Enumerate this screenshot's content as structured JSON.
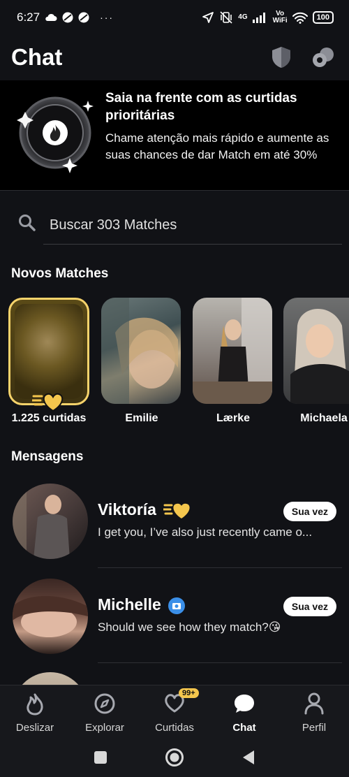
{
  "status_bar": {
    "time": "6:27",
    "dots": "···",
    "network_4g": "4G",
    "wifi_label_top": "Vo",
    "wifi_label_bottom": "WiFi",
    "battery": "100"
  },
  "header": {
    "title": "Chat",
    "icons": [
      "shield-icon",
      "chat-bubbles-icon"
    ]
  },
  "promo": {
    "title": "Saia na frente com as curtidas prioritárias",
    "description": "Chame atenção mais rápido e aumente as suas chances de dar Match em até 30%",
    "badge_icon": "flame-icon"
  },
  "search": {
    "placeholder": "Buscar 303 Matches"
  },
  "new_matches": {
    "label": "Novos Matches",
    "items": [
      {
        "name": "1.225 curtidas"
      },
      {
        "name": "Emilie"
      },
      {
        "name": "Lærke"
      },
      {
        "name": "Michaela"
      }
    ]
  },
  "messages": {
    "label": "Mensagens",
    "items": [
      {
        "name": "Viktoría",
        "preview": "I get you, I’ve also just recently came o...",
        "badge": "Sua vez",
        "icon": "priority-heart-icon"
      },
      {
        "name": "Michelle",
        "preview": "Should we see how they match?😘",
        "badge": "Sua vez",
        "icon": "verified-camera-icon"
      }
    ]
  },
  "bottom_nav": {
    "items": [
      {
        "label": "Deslizar",
        "icon": "flame-outline-icon"
      },
      {
        "label": "Explorar",
        "icon": "compass-icon"
      },
      {
        "label": "Curtidas",
        "icon": "heart-icon",
        "badge": "99+"
      },
      {
        "label": "Chat",
        "icon": "chat-bubble-icon",
        "active": true
      },
      {
        "label": "Perfil",
        "icon": "person-icon"
      }
    ]
  },
  "colors": {
    "background": "#111216",
    "gold": "#f7d36b",
    "verified_blue": "#3b8fe8"
  }
}
